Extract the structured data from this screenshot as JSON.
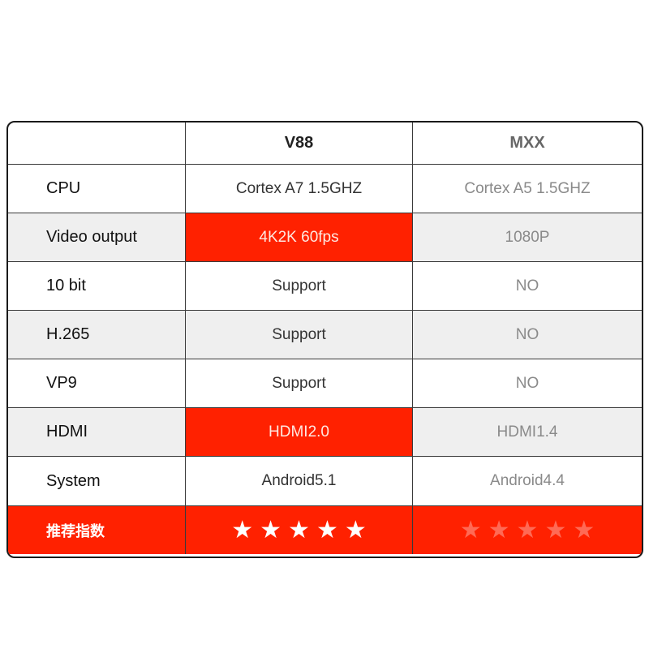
{
  "header": {
    "corner": "",
    "col1": "V88",
    "col2": "MXX"
  },
  "rows": [
    {
      "label": "CPU",
      "v88": "Cortex A7 1.5GHZ",
      "mxx": "Cortex A5 1.5GHZ",
      "shaded": false,
      "highlight": false
    },
    {
      "label": "Video output",
      "v88": "4K2K 60fps",
      "mxx": "1080P",
      "shaded": true,
      "highlight": true
    },
    {
      "label": "10 bit",
      "v88": "Support",
      "mxx": "NO",
      "shaded": false,
      "highlight": false
    },
    {
      "label": "H.265",
      "v88": "Support",
      "mxx": "NO",
      "shaded": true,
      "highlight": false
    },
    {
      "label": "VP9",
      "v88": "Support",
      "mxx": "NO",
      "shaded": false,
      "highlight": false
    },
    {
      "label": "HDMI",
      "v88": "HDMI2.0",
      "mxx": "HDMI1.4",
      "shaded": true,
      "highlight": true
    },
    {
      "label": "System",
      "v88": "Android5.1",
      "mxx": "Android4.4",
      "shaded": false,
      "highlight": false
    }
  ],
  "rating": {
    "label": "推荐指数",
    "v88_stars": 5,
    "mxx_stars": 5,
    "v88_style": "bright",
    "mxx_style": "faded",
    "star_glyph": "★"
  },
  "colors": {
    "accent": "#ff2100",
    "shade": "#efefef",
    "faded_star": "#ff6a55"
  }
}
